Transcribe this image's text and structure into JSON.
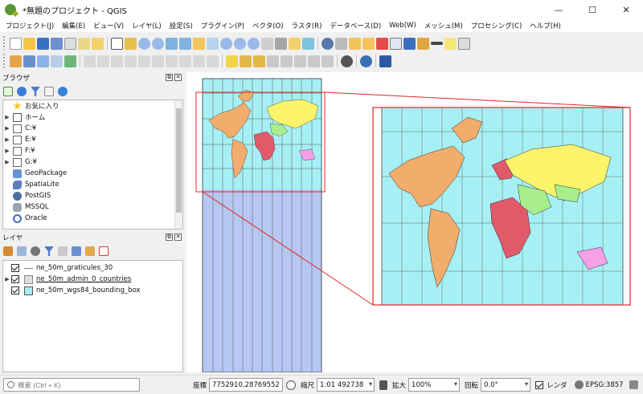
{
  "window": {
    "title": "*無題のプロジェクト - QGIS",
    "controls": [
      "—",
      "☐",
      "✕"
    ]
  },
  "menu": [
    "プロジェクト(J)",
    "編集(E)",
    "ビュー(V)",
    "レイヤ(L)",
    "設定(S)",
    "プラグイン(P)",
    "ベクタ(O)",
    "ラスタ(R)",
    "データベース(D)",
    "Web(W)",
    "メッシュ(M)",
    "プロセシング(C)",
    "ヘルプ(H)"
  ],
  "browser": {
    "title": "ブラウザ",
    "items": [
      {
        "label": "お気に入り",
        "icon": "star-icon",
        "expand": false
      },
      {
        "label": "ホーム",
        "icon": "home-icon",
        "expand": true
      },
      {
        "label": "C:¥",
        "icon": "folder-icon",
        "expand": true
      },
      {
        "label": "E:¥",
        "icon": "folder-icon",
        "expand": true
      },
      {
        "label": "F:¥",
        "icon": "folder-icon",
        "expand": true
      },
      {
        "label": "G:¥",
        "icon": "folder-icon",
        "expand": true
      },
      {
        "label": "GeoPackage",
        "icon": "geopackage-icon",
        "expand": false
      },
      {
        "label": "SpatiaLite",
        "icon": "spatialite-icon",
        "expand": false
      },
      {
        "label": "PostGIS",
        "icon": "postgis-icon",
        "expand": false
      },
      {
        "label": "MSSQL",
        "icon": "mssql-icon",
        "expand": false
      },
      {
        "label": "Oracle",
        "icon": "oracle-icon",
        "expand": false
      }
    ]
  },
  "layers": {
    "title": "レイヤ",
    "items": [
      {
        "label": "ne_50m_graticules_30",
        "checked": true,
        "expand": false,
        "symbol": "line"
      },
      {
        "label": "ne_50m_admin_0_countries",
        "checked": true,
        "expand": true,
        "symbol": "group"
      },
      {
        "label": "ne_50m_wgs84_bounding_box",
        "checked": true,
        "expand": false,
        "symbol": "fill"
      }
    ]
  },
  "status": {
    "locator_placeholder": "検索 (Ctrl + K)",
    "coord_label": "座標",
    "coord_value": "7752910,28769552",
    "scale_label": "縮尺",
    "scale_value": "1:01 492738",
    "magnify_label": "拡大",
    "magnify_value": "100%",
    "rotation_label": "回転",
    "rotation_value": "0.0°",
    "render_label": "レンダ",
    "crs_label": "EPSG:3857"
  },
  "colors": {
    "ocean": "#a6f0f5",
    "americas": "#f2ac6b",
    "africa": "#e05a6a",
    "asia": "#fbf36a",
    "middle_east": "#a8ee8d",
    "oceania": "#f79fe8",
    "antarctic_box": "#b6c8f2",
    "inset_frame": "#e02424"
  }
}
